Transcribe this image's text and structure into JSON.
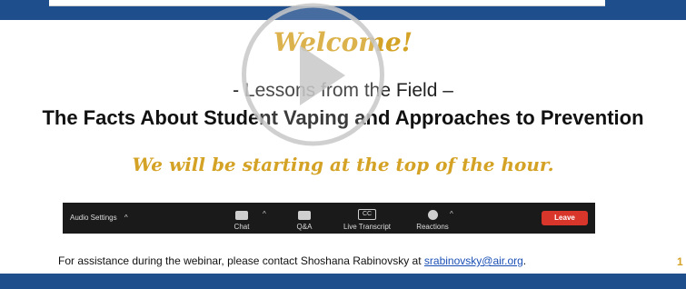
{
  "slide": {
    "welcome": "Welcome!",
    "subtitle": "- Lessons from the Field –",
    "title": "The Facts About Student Vaping and Approaches to Prevention",
    "starting": "We will be starting at the top of the hour.",
    "assist_prefix": "For assistance during the webinar, please contact Shoshana Rabinovsky at ",
    "assist_email": "srabinovsky@air.org",
    "assist_suffix": ".",
    "page_number": "1"
  },
  "zoom_toolbar": {
    "audio_settings": "Audio Settings",
    "chat": "Chat",
    "qa": "Q&A",
    "cc_icon_text": "CC",
    "live_transcript": "Live Transcript",
    "reactions": "Reactions",
    "leave": "Leave",
    "caret": "^"
  },
  "colors": {
    "brand_blue": "#1f4e8c",
    "gold": "#d4a224",
    "leave_red": "#d9362b"
  },
  "icons": [
    "play-icon",
    "chat-icon",
    "qa-icon",
    "cc-icon",
    "reactions-icon",
    "chevron-up-icon"
  ]
}
